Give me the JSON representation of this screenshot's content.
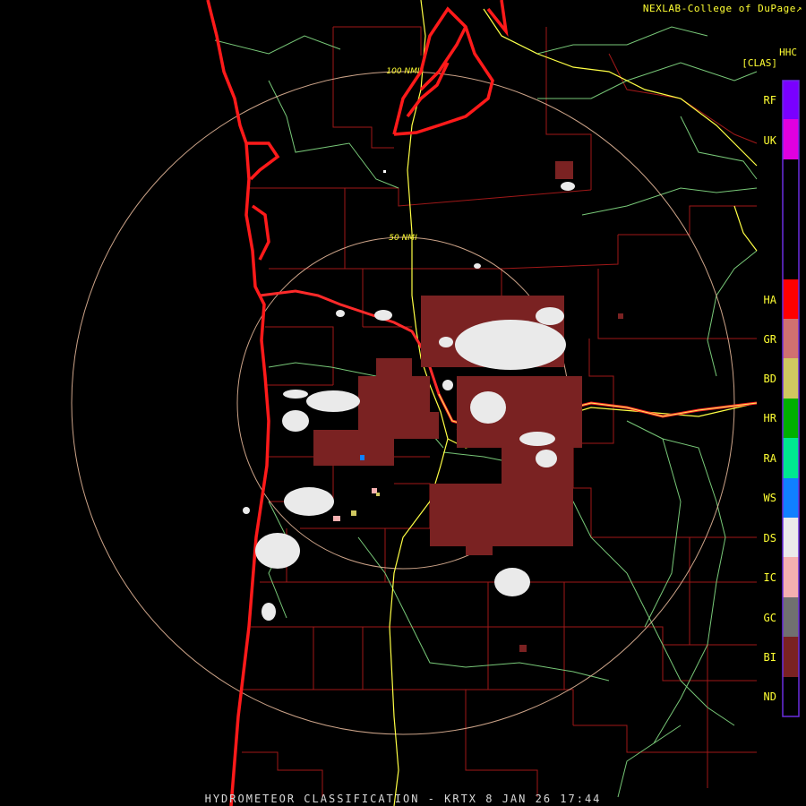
{
  "credit": "NEXLAB-College of DuPage",
  "credit_arrow": "↗",
  "product": {
    "code": "HHC",
    "sub_label": "[CLAS]"
  },
  "range_rings": [
    "50 NMI",
    "100 NMI"
  ],
  "legend": [
    {
      "code": "RF",
      "color": "#7a00ff"
    },
    {
      "code": "UK",
      "color": "#e000e0"
    },
    {
      "code": "HA",
      "color": "#ff0000"
    },
    {
      "code": "GR",
      "color": "#d07070"
    },
    {
      "code": "BD",
      "color": "#d0c860"
    },
    {
      "code": "HR",
      "color": "#00b000"
    },
    {
      "code": "RA",
      "color": "#00e890"
    },
    {
      "code": "WS",
      "color": "#1080ff"
    },
    {
      "code": "DS",
      "color": "#eaeaea"
    },
    {
      "code": "IC",
      "color": "#f4b0b0"
    },
    {
      "code": "GC",
      "color": "#707070"
    },
    {
      "code": "BI",
      "color": "#7a2222"
    },
    {
      "code": "ND",
      "color": "#000000"
    }
  ],
  "footer": "HYDROMETEOR CLASSIFICATION - KRTX 8 JAN 26 17:44",
  "colors": {
    "background": "#000000",
    "label_yellow": "#ffff33",
    "legend_border": "#6a2ee0",
    "coastline": "#ff1a1a",
    "county_lines": "#a01818",
    "highway": "#ffff44",
    "rivers": "#78c878",
    "range_ring": "#f0c0a0"
  }
}
